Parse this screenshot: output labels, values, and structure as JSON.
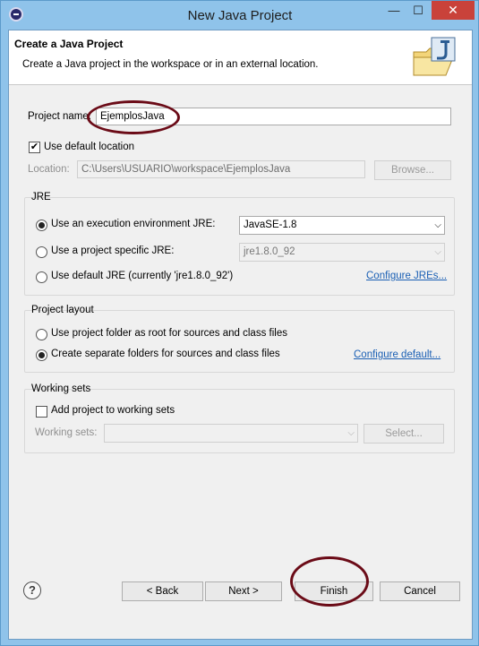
{
  "window": {
    "title": "New Java Project",
    "minimize_glyph": "—",
    "maximize_glyph": "☐",
    "close_glyph": "✕"
  },
  "header": {
    "title": "Create a Java Project",
    "description": "Create a Java project in the workspace or in an external location."
  },
  "project_name": {
    "label": "Project name:",
    "value": "EjemplosJava"
  },
  "location": {
    "use_default_label": "Use default location",
    "use_default_checked": true,
    "label": "Location:",
    "value": "C:\\Users\\USUARIO\\workspace\\EjemplosJava",
    "browse_label": "Browse..."
  },
  "jre": {
    "group_title": "JRE",
    "option_env_label": "Use an execution environment JRE:",
    "option_env_value": "JavaSE-1.8",
    "option_specific_label": "Use a project specific JRE:",
    "option_specific_value": "jre1.8.0_92",
    "option_default_label": "Use default JRE (currently 'jre1.8.0_92')",
    "configure_link": "Configure JREs...",
    "selected": "execution-environment"
  },
  "layout": {
    "group_title": "Project layout",
    "option_root_label": "Use project folder as root for sources and class files",
    "option_separate_label": "Create separate folders for sources and class files",
    "configure_link": "Configure default...",
    "selected": "separate"
  },
  "working_sets": {
    "group_title": "Working sets",
    "add_label": "Add project to working sets",
    "add_checked": false,
    "label": "Working sets:",
    "value": "",
    "select_label": "Select..."
  },
  "footer": {
    "help_glyph": "?",
    "back_label": "< Back",
    "next_label": "Next >",
    "finish_label": "Finish",
    "cancel_label": "Cancel"
  },
  "icons": {
    "app": "eclipse-icon",
    "wizard": "java-project-folder-icon",
    "help": "help-icon",
    "checkmark": "✔",
    "dropdown_arrow": "⌵"
  },
  "colors": {
    "title_bar": "#8fc3ea",
    "close_button": "#c9423a",
    "annotation": "#6b0b17",
    "link": "#1a5fb4"
  }
}
